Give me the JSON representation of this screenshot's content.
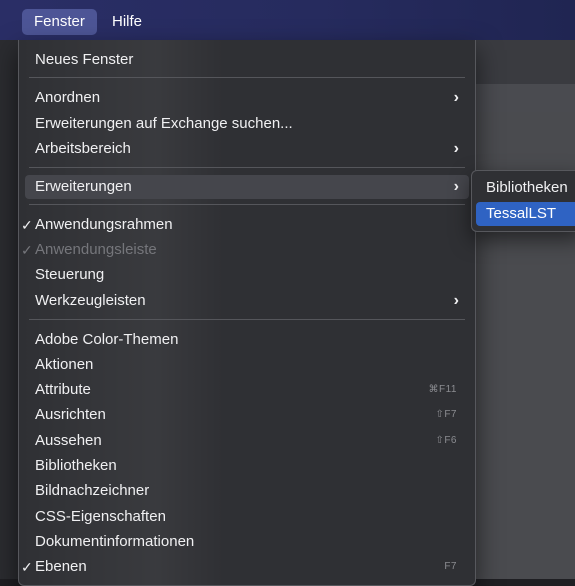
{
  "menubar": {
    "items": [
      {
        "label": "Fenster"
      },
      {
        "label": "Hilfe"
      }
    ]
  },
  "menu": {
    "items": [
      {
        "label": "Neues Fenster"
      },
      {
        "label": "Anordnen"
      },
      {
        "label": "Erweiterungen auf Exchange suchen..."
      },
      {
        "label": "Arbeitsbereich"
      },
      {
        "label": "Erweiterungen"
      },
      {
        "label": "Anwendungsrahmen",
        "check": "✓"
      },
      {
        "label": "Anwendungsleiste",
        "check": "✓"
      },
      {
        "label": "Steuerung"
      },
      {
        "label": "Werkzeugleisten"
      },
      {
        "label": "Adobe Color-Themen"
      },
      {
        "label": "Aktionen"
      },
      {
        "label": "Attribute",
        "shortcut": "⌘F11"
      },
      {
        "label": "Ausrichten",
        "shortcut": "⇧F7"
      },
      {
        "label": "Aussehen",
        "shortcut": "⇧F6"
      },
      {
        "label": "Bibliotheken"
      },
      {
        "label": "Bildnachzeichner"
      },
      {
        "label": "CSS-Eigenschaften"
      },
      {
        "label": "Dokumentinformationen"
      },
      {
        "label": "Ebenen",
        "check": "✓",
        "shortcut": "F7"
      }
    ]
  },
  "submenu": {
    "items": [
      {
        "label": "Bibliotheken"
      },
      {
        "label": "TessalLST"
      }
    ]
  },
  "icons": {
    "chevron": "›",
    "check": "✓"
  }
}
